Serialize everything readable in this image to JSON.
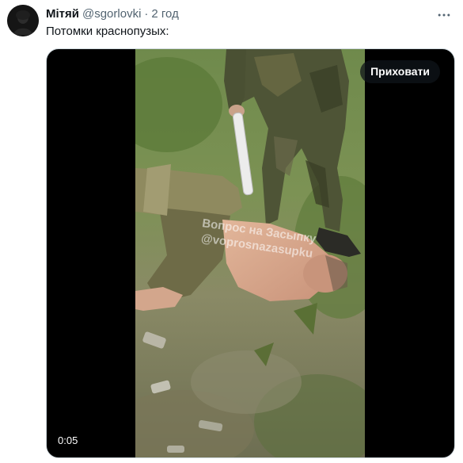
{
  "tweet": {
    "author": {
      "display_name": "Мітяй",
      "handle": "@sgorlovki",
      "separator": "·",
      "time": "2 год"
    },
    "text": "Потомки краснопузых:",
    "more_icon": "more-horizontal-icon",
    "media": {
      "type": "video",
      "hide_label": "Приховати",
      "duration": "0:05",
      "watermark_line1": "Вопрос на Засыпку",
      "watermark_line2": "@voprosnazasupku"
    }
  },
  "colors": {
    "text_primary": "#0f1419",
    "text_secondary": "#536471",
    "media_border": "#cfd9de",
    "overlay": "rgba(15,20,25,0.75)"
  }
}
